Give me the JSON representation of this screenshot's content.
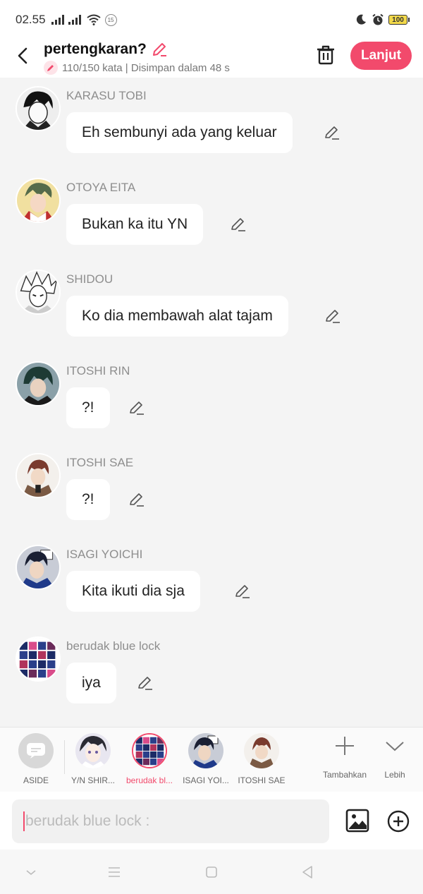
{
  "status_bar": {
    "time": "02.55",
    "notification_count": "15",
    "battery": "100"
  },
  "header": {
    "title": "pertengkaran?",
    "word_count": "110/150 kata | Disimpan dalam 48 s",
    "next_label": "Lanjut"
  },
  "messages": [
    {
      "name": "KARASU TOBI",
      "text": "Eh sembunyi ada yang keluar"
    },
    {
      "name": "OTOYA EITA",
      "text": "Bukan ka itu YN"
    },
    {
      "name": "SHIDOU",
      "text": "Ko dia membawah alat tajam"
    },
    {
      "name": "ITOSHI RIN",
      "text": "?!"
    },
    {
      "name": "ITOSHI SAE",
      "text": "?!"
    },
    {
      "name": "ISAGI YOICHI",
      "text": "Kita ikuti dia sja"
    },
    {
      "name": "berudak blue lock",
      "text": "iya"
    }
  ],
  "characters": [
    {
      "label": "ASIDE"
    },
    {
      "label": "Y/N SHIR..."
    },
    {
      "label": "berudak bl..."
    },
    {
      "label": "ISAGI YOI..."
    },
    {
      "label": "ITOSHI SAE"
    }
  ],
  "actions": {
    "add_label": "Tambahkan",
    "more_label": "Lebih"
  },
  "input": {
    "placeholder": "berudak blue lock :"
  },
  "colors": {
    "accent": "#f24a6c",
    "background": "#f4f4f4",
    "bubble": "#ffffff"
  }
}
